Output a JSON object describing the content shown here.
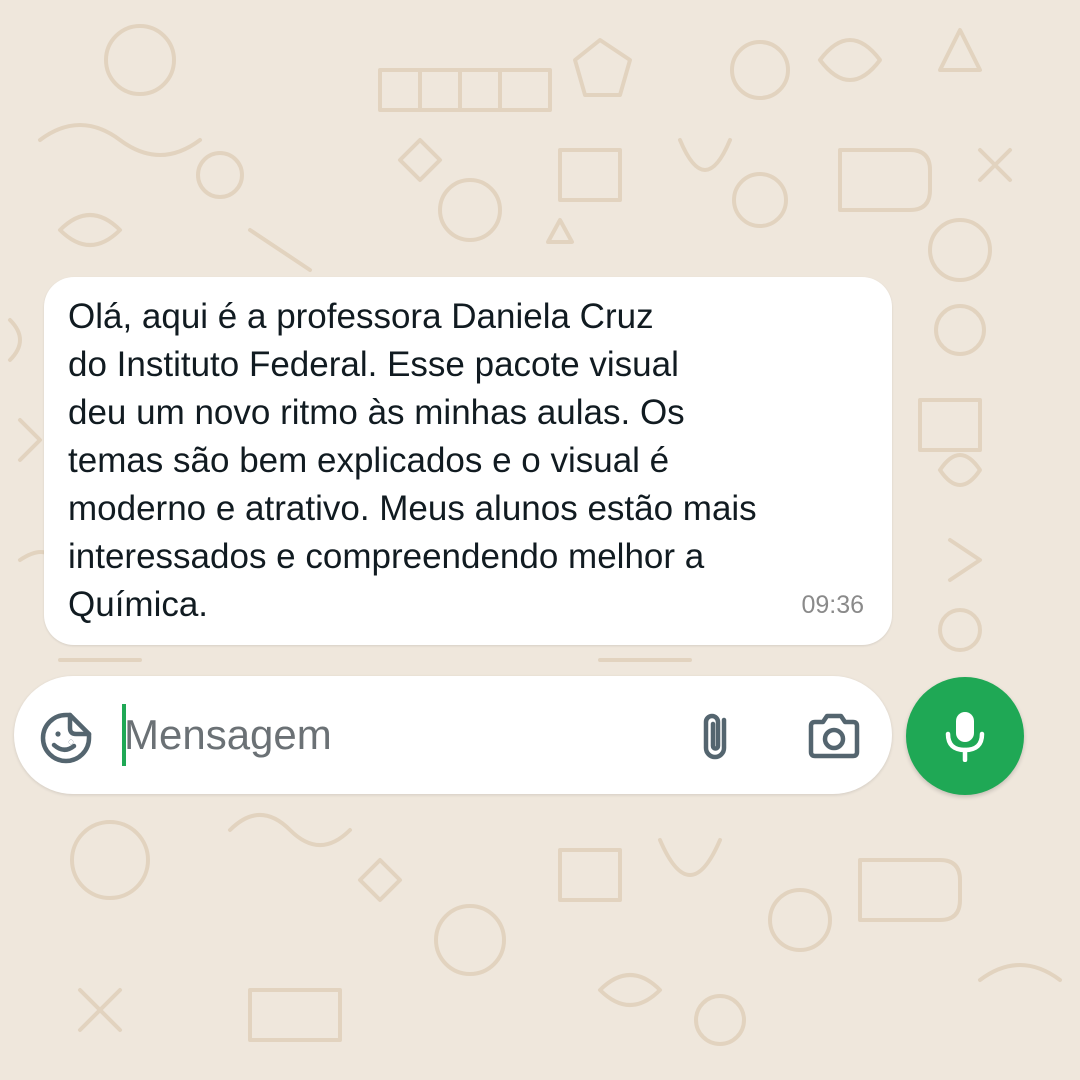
{
  "message": {
    "text": "Olá, aqui é a professora Daniela Cruz\ndo Instituto Federal. Esse pacote visual\ndeu um novo ritmo às minhas aulas. Os\ntemas são bem explicados e o visual é\nmoderno e atrativo. Meus alunos estão mais\ninteressados e compreendendo melhor a\nQuímica.",
    "time": "09:36"
  },
  "composer": {
    "placeholder": "Mensagem",
    "value": "",
    "icons": {
      "emoji": "sticker-icon",
      "attach": "paperclip-icon",
      "camera": "camera-icon",
      "send": "microphone-icon"
    }
  },
  "colors": {
    "wallpaper": "#efe7dc",
    "wallpaper_doodle": "#e2d3bf",
    "bubble": "#ffffff",
    "accent": "#1fa855",
    "icon": "#54656f"
  }
}
